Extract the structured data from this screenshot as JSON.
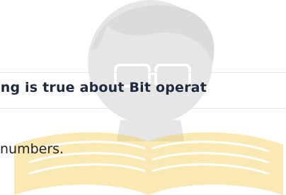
{
  "question": {
    "text": "ing is true about Bit operat"
  },
  "option": {
    "text": "numbers."
  },
  "watermark": {
    "icon": "reader-with-book-watermark-icon",
    "head_color": "#b8b8b8",
    "book_color": "#f4cf57"
  }
}
